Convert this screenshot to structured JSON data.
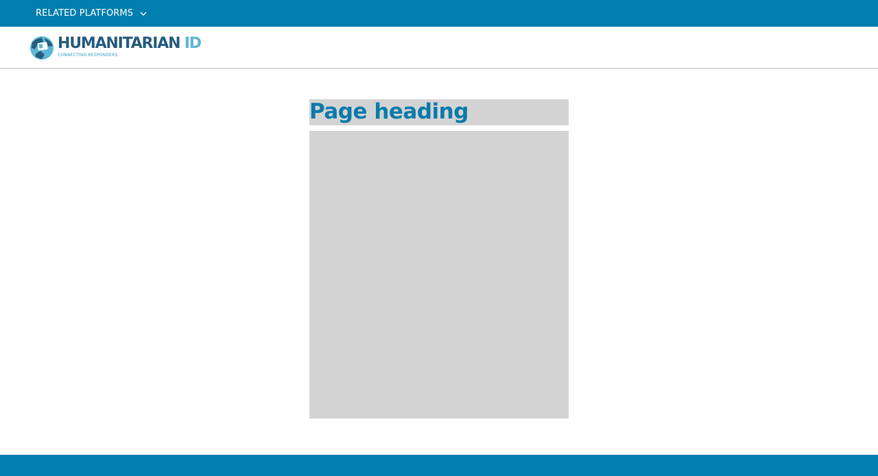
{
  "topbar": {
    "menu_label": "RELATED PLATFORMS",
    "chevron_icon": "chevron-down-icon"
  },
  "header": {
    "logo": {
      "name": "HUMANITARIAN",
      "suffix": "ID",
      "tagline": "CONNECTING RESPONDERS",
      "icon": "globe-id-logo-icon"
    }
  },
  "main": {
    "page_heading": "Page heading"
  },
  "colors": {
    "brand_blue": "#027fae",
    "heading_blue": "#0a7bab",
    "logo_dark": "#265d7f",
    "logo_light": "#5db6d6",
    "placeholder_gray": "#d3d3d3"
  }
}
